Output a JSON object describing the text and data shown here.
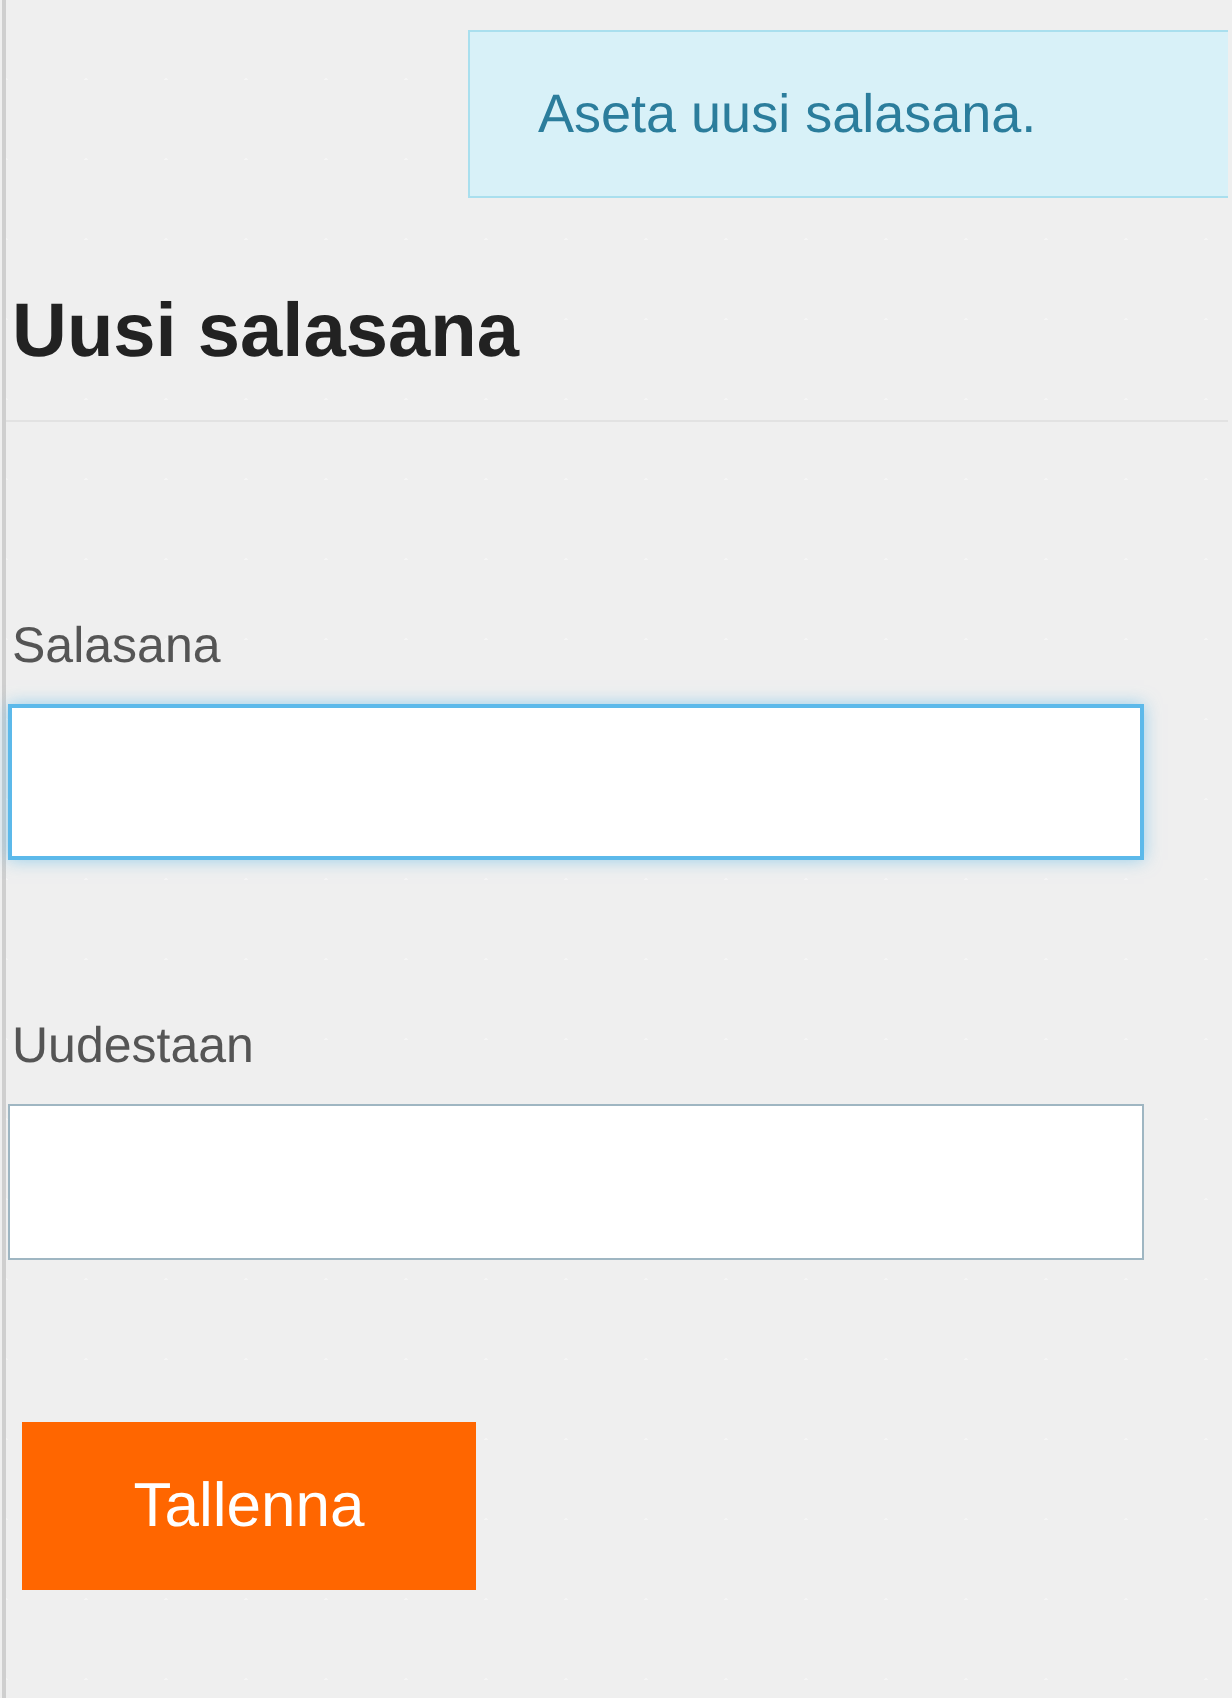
{
  "notice": {
    "text": "Aseta uusi salasana."
  },
  "heading": "Uusi salasana",
  "fields": [
    {
      "label": "Salasana",
      "focused": true
    },
    {
      "label": "Uudestaan",
      "focused": false
    }
  ],
  "button": {
    "label": "Tallenna"
  }
}
